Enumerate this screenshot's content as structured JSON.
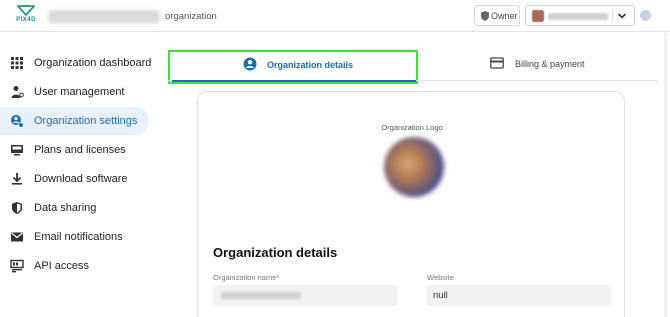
{
  "header": {
    "logo_text": "PIX4D",
    "org_suffix": "organization",
    "owner_label": "Owner",
    "brand_color": "#1a8a8a"
  },
  "sidebar": {
    "items": [
      {
        "label": "Organization dashboard",
        "icon": "grid-icon"
      },
      {
        "label": "User management",
        "icon": "user-manage-icon"
      },
      {
        "label": "Organization settings",
        "icon": "settings-gear-icon",
        "active": true
      },
      {
        "label": "Plans and licenses",
        "icon": "monitor-icon"
      },
      {
        "label": "Download software",
        "icon": "download-icon"
      },
      {
        "label": "Data sharing",
        "icon": "shield-icon"
      },
      {
        "label": "Email notifications",
        "icon": "mail-icon"
      },
      {
        "label": "API access",
        "icon": "api-icon"
      }
    ],
    "active_color": "#1b6fae"
  },
  "tabs": [
    {
      "label": "Organization details",
      "icon": "account-circle-icon",
      "active": true
    },
    {
      "label": "Billing & payment",
      "icon": "credit-card-icon"
    }
  ],
  "card": {
    "logo_label": "Organization Logo",
    "section_title": "Organization details",
    "fields": {
      "org_name_label": "Organization name*",
      "website_label": "Website",
      "website_value": "null"
    }
  }
}
